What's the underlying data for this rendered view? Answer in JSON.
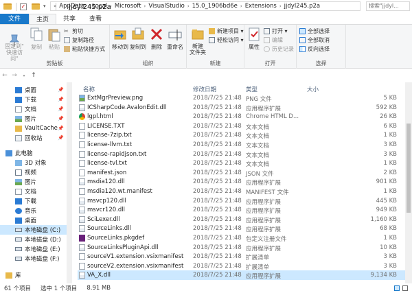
{
  "window": {
    "title": "jjdyl245.p2a"
  },
  "ribbon_tabs": [
    {
      "label": "文件"
    },
    {
      "label": "主页"
    },
    {
      "label": "共享"
    },
    {
      "label": "查看"
    }
  ],
  "ribbon": {
    "clipboard": {
      "label": "剪贴板",
      "pin_quick": "固定到\"\n快速访问\"",
      "copy": "复制",
      "paste": "粘贴",
      "cut": "剪切",
      "copy_path": "复制路径",
      "paste_shortcut": "粘贴快捷方式"
    },
    "organize": {
      "label": "组织",
      "move_to": "移动到",
      "copy_to": "复制到",
      "delete": "删除",
      "rename": "重命名"
    },
    "new": {
      "label": "新建",
      "new_folder": "新建\n文件夹",
      "new_item": "新建项目 ▾",
      "easy_access": "轻松访问 ▾"
    },
    "open": {
      "label": "打开",
      "properties": "属性",
      "open": "打开 ▾",
      "edit": "编辑",
      "history": "历史记录"
    },
    "select": {
      "label": "选择",
      "select_all": "全部选择",
      "select_none": "全部取消",
      "invert": "反向选择"
    }
  },
  "address": {
    "crumbs": [
      "AppData",
      "Local",
      "Microsoft",
      "VisualStudio",
      "15.0_1906bd6e",
      "Extensions",
      "jjdyl245.p2a"
    ],
    "search_placeholder": "搜索\"jjdyl..."
  },
  "nav": {
    "items": [
      {
        "label": "桌面",
        "pinned": true
      },
      {
        "label": "下载",
        "pinned": true
      },
      {
        "label": "文档",
        "pinned": true
      },
      {
        "label": "图片",
        "pinned": true
      },
      {
        "label": "VaultCache",
        "pinned": true
      },
      {
        "label": "回收站",
        "pinned": true
      },
      {
        "label": "此电脑",
        "pinned": false
      },
      {
        "label": "3D 对象",
        "pinned": false
      },
      {
        "label": "视频",
        "pinned": false
      },
      {
        "label": "图片",
        "pinned": false
      },
      {
        "label": "文档",
        "pinned": false
      },
      {
        "label": "下载",
        "pinned": false
      },
      {
        "label": "音乐",
        "pinned": false
      },
      {
        "label": "桌面",
        "pinned": false
      },
      {
        "label": "本地磁盘 (C:)",
        "pinned": false
      },
      {
        "label": "本地磁盘 (D:)",
        "pinned": false
      },
      {
        "label": "本地磁盘 (E:)",
        "pinned": false
      },
      {
        "label": "本地磁盘 (F:)",
        "pinned": false
      },
      {
        "label": "库",
        "pinned": false
      }
    ]
  },
  "columns": {
    "name": "名称",
    "date": "修改日期",
    "type": "类型",
    "size": "大小"
  },
  "files": [
    {
      "name": "ExtMgrPreview.png",
      "date": "2018/7/25 21:48",
      "type": "PNG 文件",
      "size": "5 KB",
      "icon": "img"
    },
    {
      "name": "ICSharpCode.AvalonEdit.dll",
      "date": "2018/7/25 21:48",
      "type": "应用程序扩展",
      "size": "592 KB",
      "icon": "dll"
    },
    {
      "name": "lgpl.html",
      "date": "2018/7/25 21:48",
      "type": "Chrome HTML D...",
      "size": "26 KB",
      "icon": "chrome"
    },
    {
      "name": "LICENSE.TXT",
      "date": "2018/7/25 21:48",
      "type": "文本文档",
      "size": "6 KB",
      "icon": "txt"
    },
    {
      "name": "license-7zip.txt",
      "date": "2018/7/25 21:48",
      "type": "文本文档",
      "size": "1 KB",
      "icon": "txt"
    },
    {
      "name": "license-llvm.txt",
      "date": "2018/7/25 21:48",
      "type": "文本文档",
      "size": "3 KB",
      "icon": "txt"
    },
    {
      "name": "license-rapidjson.txt",
      "date": "2018/7/25 21:48",
      "type": "文本文档",
      "size": "3 KB",
      "icon": "txt"
    },
    {
      "name": "license-tvl.txt",
      "date": "2018/7/25 21:48",
      "type": "文本文档",
      "size": "1 KB",
      "icon": "txt"
    },
    {
      "name": "manifest.json",
      "date": "2018/7/25 21:48",
      "type": "JSON 文件",
      "size": "2 KB",
      "icon": "txt"
    },
    {
      "name": "msdia120.dll",
      "date": "2018/7/25 21:48",
      "type": "应用程序扩展",
      "size": "901 KB",
      "icon": "dll"
    },
    {
      "name": "msdia120.wt.manifest",
      "date": "2018/7/25 21:48",
      "type": "MANIFEST 文件",
      "size": "1 KB",
      "icon": "txt"
    },
    {
      "name": "msvcp120.dll",
      "date": "2018/7/25 21:48",
      "type": "应用程序扩展",
      "size": "445 KB",
      "icon": "dll"
    },
    {
      "name": "msvcr120.dll",
      "date": "2018/7/25 21:48",
      "type": "应用程序扩展",
      "size": "949 KB",
      "icon": "dll"
    },
    {
      "name": "SciLexer.dll",
      "date": "2018/7/25 21:48",
      "type": "应用程序扩展",
      "size": "1,160 KB",
      "icon": "dll"
    },
    {
      "name": "SourceLinks.dll",
      "date": "2018/7/25 21:48",
      "type": "应用程序扩展",
      "size": "68 KB",
      "icon": "dll"
    },
    {
      "name": "SourceLinks.pkgdef",
      "date": "2018/7/25 21:48",
      "type": "包定义注册文件",
      "size": "1 KB",
      "icon": "vs"
    },
    {
      "name": "SourceLinksPluginApi.dll",
      "date": "2018/7/25 21:48",
      "type": "应用程序扩展",
      "size": "10 KB",
      "icon": "dll"
    },
    {
      "name": "sourceV1.extension.vsixmanifest",
      "date": "2018/7/25 21:48",
      "type": "扩展清单",
      "size": "3 KB",
      "icon": "txt"
    },
    {
      "name": "sourceV2.extension.vsixmanifest",
      "date": "2018/7/25 21:48",
      "type": "扩展清单",
      "size": "3 KB",
      "icon": "txt"
    },
    {
      "name": "VA_X.dll",
      "date": "2018/7/25 21:48",
      "type": "应用程序扩展",
      "size": "9,134 KB",
      "icon": "dll",
      "selected": true
    }
  ],
  "status": {
    "count": "61 个项目",
    "selected": "选中 1 个项目",
    "size": "8.91 MB"
  }
}
